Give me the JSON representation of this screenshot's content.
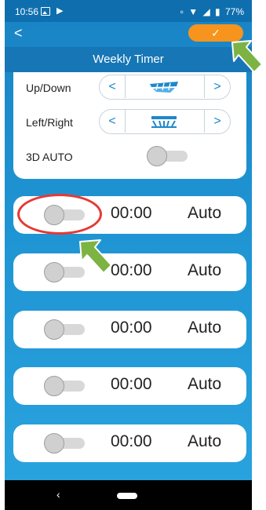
{
  "status_bar": {
    "time": "10:56",
    "battery": "77%",
    "icons": [
      "image-icon",
      "play-icon",
      "vibrate-icon",
      "wifi-icon",
      "signal-icon",
      "battery-icon"
    ]
  },
  "app_bar": {
    "back_glyph": "<",
    "confirm_glyph": "✓",
    "title": "Weekly Timer"
  },
  "settings": {
    "rows": [
      {
        "label": "Up/Down",
        "left_glyph": "<",
        "right_glyph": ">"
      },
      {
        "label": "Left/Right",
        "left_glyph": "<",
        "right_glyph": ">"
      }
    ],
    "auto3d": {
      "label": "3D AUTO",
      "on": false
    }
  },
  "timers": [
    {
      "time": "00:00",
      "mode": "Auto",
      "enabled": false
    },
    {
      "time": "00:00",
      "mode": "Auto",
      "enabled": false
    },
    {
      "time": "00:00",
      "mode": "Auto",
      "enabled": false
    },
    {
      "time": "00:00",
      "mode": "Auto",
      "enabled": false
    },
    {
      "time": "00:00",
      "mode": "Auto",
      "enabled": false
    }
  ],
  "nav_bar": {
    "back_glyph": "‹"
  },
  "colors": {
    "primary": "#1e93d2",
    "title_bar": "#1676b6",
    "accent_orange": "#f7941d",
    "highlight_red": "#e53935",
    "arrow_green": "#7cb342"
  }
}
